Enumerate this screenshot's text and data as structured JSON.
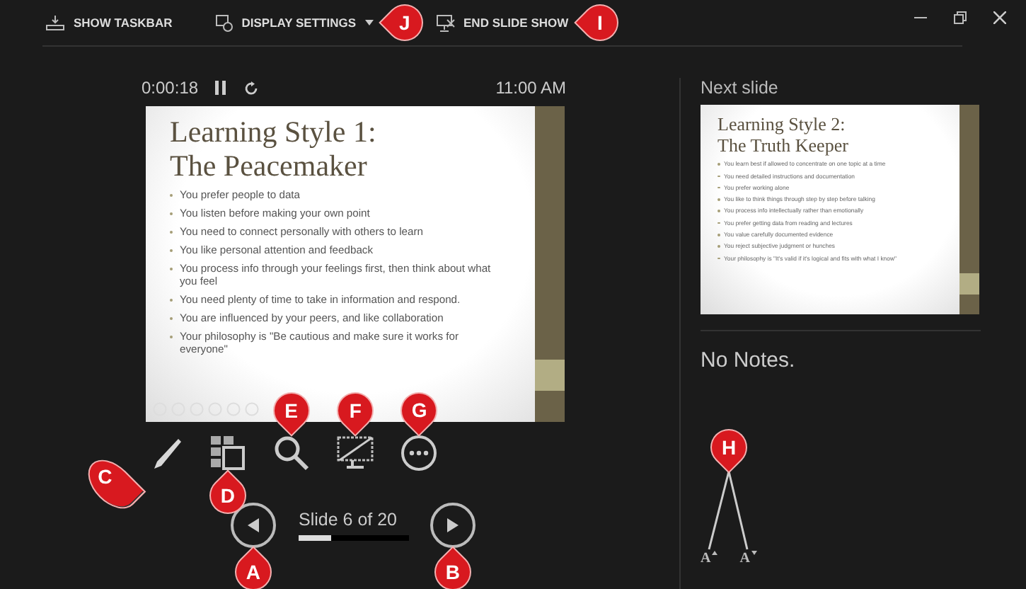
{
  "toolbar": [
    {
      "kind": "taskbar",
      "label": "SHOW TASKBAR",
      "has_menu": false
    },
    {
      "kind": "display",
      "label": "DISPLAY SETTINGS",
      "has_menu": true,
      "callout": "J"
    },
    {
      "kind": "end",
      "label": "END SLIDE SHOW",
      "has_menu": false,
      "callout": "I"
    }
  ],
  "timer": {
    "elapsed": "0:00:18",
    "clock": "11:00 AM"
  },
  "current_slide": {
    "title_lines": [
      "Learning Style 1:",
      "The Peacemaker"
    ],
    "bullets": [
      "You prefer people to data",
      "You listen before making your own point",
      "You need to connect personally with others to learn",
      "You like personal attention and feedback",
      "You process info through your feelings first, then think about what you feel",
      "You need plenty of time to take in information and respond.",
      "You are influenced by your peers, and like collaboration",
      "Your philosophy is \"Be cautious and make sure it works for everyone\""
    ]
  },
  "tools": [
    {
      "kind": "pen",
      "callout": "C"
    },
    {
      "kind": "slides",
      "callout": "D"
    },
    {
      "kind": "zoom",
      "callout": "E"
    },
    {
      "kind": "black_screen",
      "callout": "F"
    },
    {
      "kind": "more",
      "callout": "G"
    }
  ],
  "navigation": {
    "previous": {
      "callout": "A"
    },
    "label": "Slide 6 of 20",
    "level": 0.3,
    "next": {
      "callout": "B"
    }
  },
  "next_slide_panel": {
    "heading": "Next slide",
    "slide": {
      "title_lines": [
        "Learning Style 2:",
        "The Truth Keeper"
      ],
      "bullets": [
        "You learn best if allowed to concentrate on one topic at a time",
        "You need detailed instructions and documentation",
        "You prefer working alone",
        "You like to think things through step by step before talking",
        "You process info intellectually rather than emotionally",
        "You prefer getting data from reading and lectures",
        "You value carefully documented evidence",
        "You reject subjective judgment or hunches",
        "Your philosophy is \"It's valid if it's logical and fits with what I know\""
      ]
    }
  },
  "notes": "No Notes.",
  "font_size": {
    "callout": "H",
    "buttons": [
      {
        "kind": "increase",
        "label": "A"
      },
      {
        "kind": "decrease",
        "label": "A"
      }
    ]
  }
}
